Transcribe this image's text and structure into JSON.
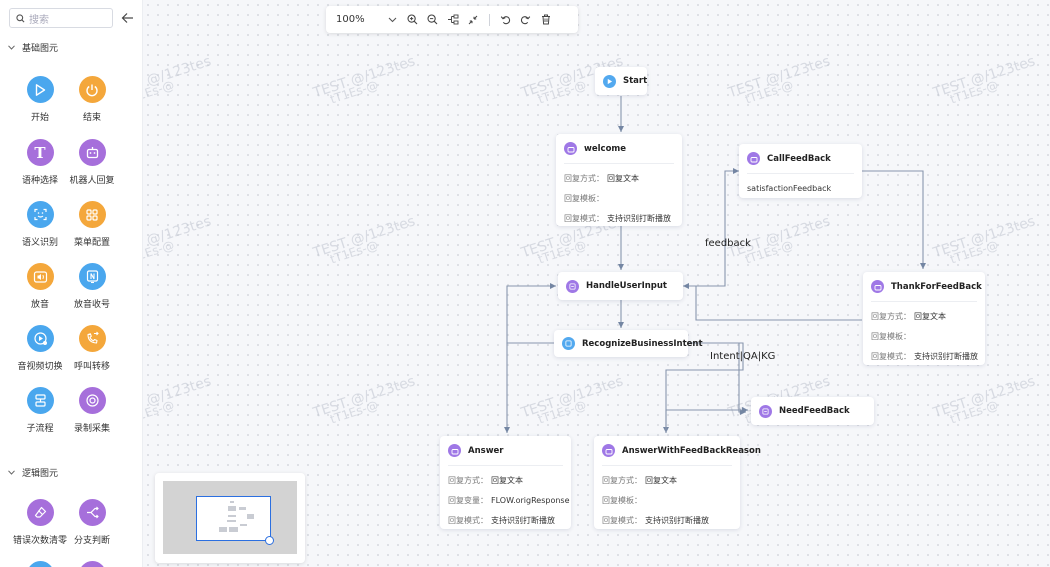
{
  "sidebar": {
    "search_placeholder": "搜索",
    "sections": [
      {
        "title": "基础图元"
      },
      {
        "title": "逻辑图元"
      }
    ],
    "basic_items": [
      {
        "label": "开始",
        "icon": "play-icon",
        "color": "#4aa7ee"
      },
      {
        "label": "结束",
        "icon": "power-icon",
        "color": "#f4a73b"
      },
      {
        "label": "语种选择",
        "icon": "text-t-icon",
        "color": "#a66fdb"
      },
      {
        "label": "机器人回复",
        "icon": "robot-icon",
        "color": "#a66fdb"
      },
      {
        "label": "语义识别",
        "icon": "scan-face-icon",
        "color": "#4aa7ee"
      },
      {
        "label": "菜单配置",
        "icon": "grid-menu-icon",
        "color": "#f4a73b"
      },
      {
        "label": "放音",
        "icon": "speaker-icon",
        "color": "#f4a73b"
      },
      {
        "label": "放音收号",
        "icon": "keypad-icon",
        "color": "#4aa7ee"
      },
      {
        "label": "音视频切换",
        "icon": "media-switch-icon",
        "color": "#4aa7ee"
      },
      {
        "label": "呼叫转移",
        "icon": "call-transfer-icon",
        "color": "#f4a73b"
      },
      {
        "label": "子流程",
        "icon": "subflow-icon",
        "color": "#4aa7ee"
      },
      {
        "label": "录制采集",
        "icon": "record-icon",
        "color": "#a66fdb"
      }
    ],
    "logic_items": [
      {
        "label": "错误次数清零",
        "icon": "eraser-icon",
        "color": "#a66fdb"
      },
      {
        "label": "分支判断",
        "icon": "branch-icon",
        "color": "#a66fdb"
      }
    ]
  },
  "toolbar": {
    "zoom": "100%"
  },
  "watermark": {
    "line1": "TEST @/123tes",
    "line2": "tT1Es-@"
  },
  "nodes": {
    "start": {
      "title": "Start"
    },
    "welcome": {
      "title": "welcome",
      "rows": [
        {
          "k": "回复方式：",
          "v": "回复文本"
        },
        {
          "k": "回复模板：",
          "v": ""
        },
        {
          "k": "回复模式：",
          "v": "支持识别打断播放"
        }
      ]
    },
    "callfeedback": {
      "title": "CallFeedBack",
      "rows": [
        {
          "k": "",
          "v": "satisfactionFeedback"
        }
      ]
    },
    "handleuserinput": {
      "title": "HandleUserInput"
    },
    "thankforfeedback": {
      "title": "ThankForFeedBack",
      "rows": [
        {
          "k": "回复方式：",
          "v": "回复文本"
        },
        {
          "k": "回复模板：",
          "v": ""
        },
        {
          "k": "回复模式：",
          "v": "支持识别打断播放"
        }
      ]
    },
    "recognize": {
      "title": "RecognizeBusinessIntent"
    },
    "needfeedback": {
      "title": "NeedFeedBack"
    },
    "answer": {
      "title": "Answer",
      "rows": [
        {
          "k": "回复方式：",
          "v": "回复文本"
        },
        {
          "k": "回复变量：",
          "v": "FLOW.origResponse"
        },
        {
          "k": "回复模式：",
          "v": "支持识别打断播放"
        }
      ]
    },
    "answerwithfeedback": {
      "title": "AnswerWithFeedBackReason",
      "rows": [
        {
          "k": "回复方式：",
          "v": "回复文本"
        },
        {
          "k": "回复模板：",
          "v": ""
        },
        {
          "k": "回复模式：",
          "v": "支持识别打断播放"
        }
      ]
    }
  },
  "edge_labels": {
    "feedback": "feedback",
    "intent": "Intent|QA|KG"
  }
}
